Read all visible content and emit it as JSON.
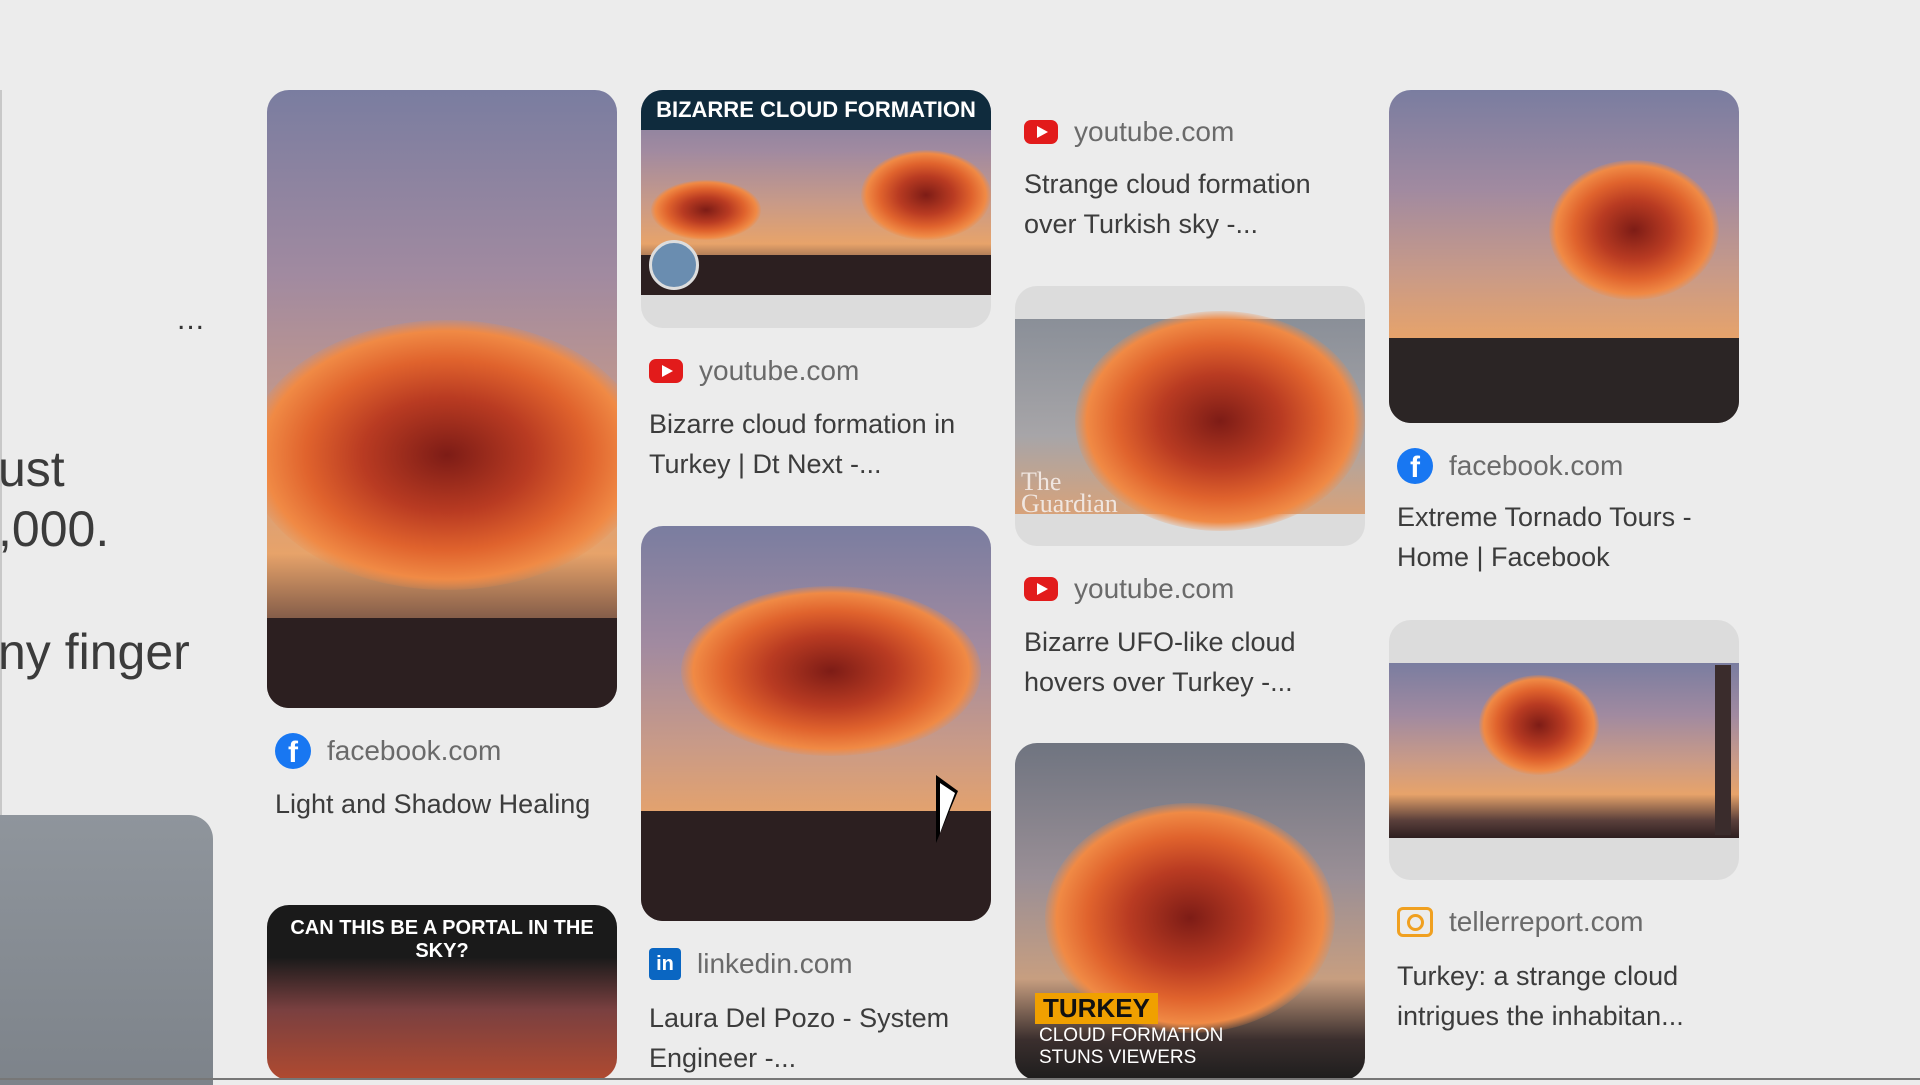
{
  "left_panel": {
    "more_label": "...",
    "text_lines": [
      "ust",
      ",000.",
      "ny finger"
    ]
  },
  "cards": [
    {
      "source": "facebook.com",
      "title": "Light and Shadow Healing"
    },
    {
      "source": "youtube.com",
      "title": "Bizarre cloud formation in Turkey | Dt Next -...",
      "overlay": "BIZARRE CLOUD FORMATION"
    },
    {
      "source": "linkedin.com",
      "title": "Laura Del Pozo - System Engineer -..."
    },
    {
      "source": "youtube.com",
      "title": "Strange cloud formation over Turkish sky -..."
    },
    {
      "source": "youtube.com",
      "title": "Bizarre UFO-like cloud hovers over Turkey -...",
      "overlay": "The Guardian"
    },
    {
      "source": "facebook.com",
      "title": "Extreme Tornado Tours - Home | Facebook"
    },
    {
      "source": "tellerreport.com",
      "title": "Turkey: a strange cloud intrigues the inhabitan..."
    }
  ],
  "thumb_overlays": {
    "portal": "CAN THIS BE A PORTAL IN THE SKY?",
    "turkey": "TURKEY",
    "turkey_sub": "CLOUD FORMATION STUNS VIEWERS"
  }
}
